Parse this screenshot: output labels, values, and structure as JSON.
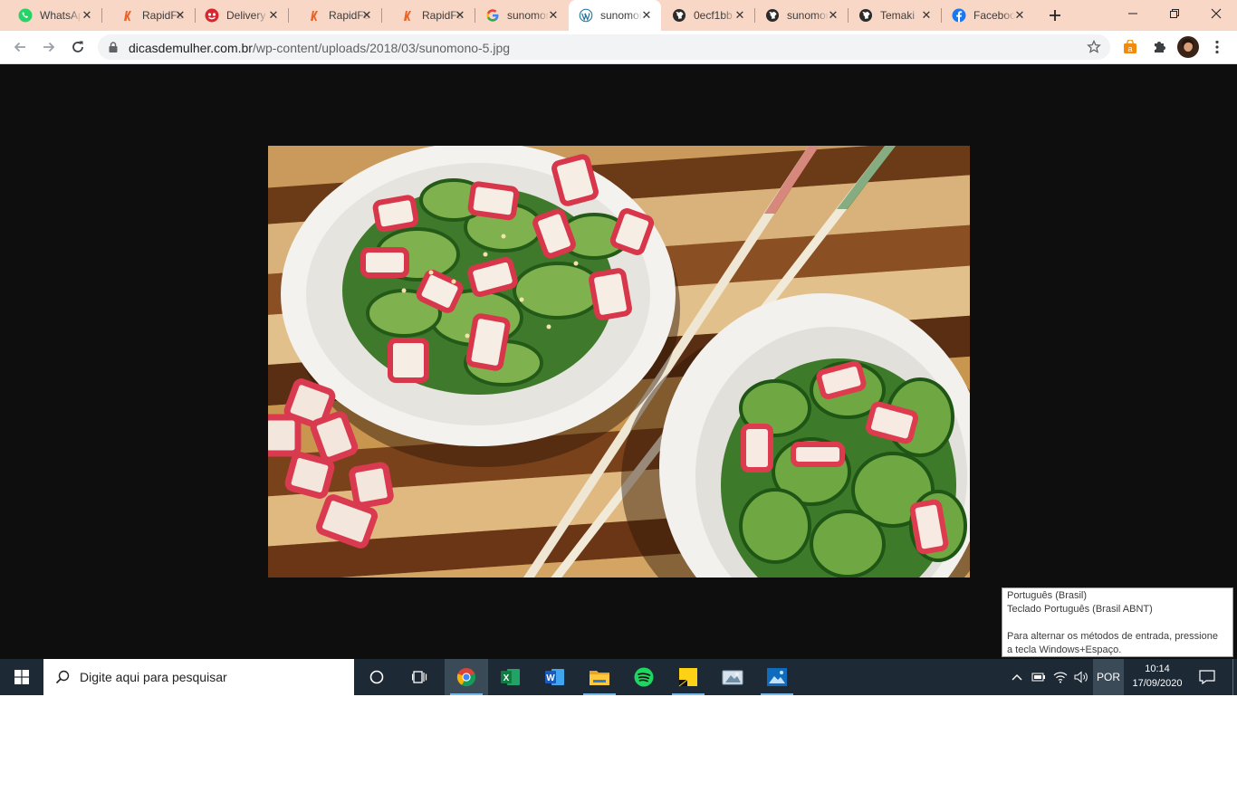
{
  "tabs": [
    {
      "title": "WhatsApp",
      "icon": "whatsapp-icon"
    },
    {
      "title": "RapidFood",
      "icon": "rapidfood-icon"
    },
    {
      "title": "Delivery",
      "icon": "delivery-icon"
    },
    {
      "title": "RapidFood",
      "icon": "rapidfood-icon"
    },
    {
      "title": "RapidFood",
      "icon": "rapidfood-icon"
    },
    {
      "title": "sunomono",
      "icon": "google-icon"
    },
    {
      "title": "sunomono",
      "icon": "wordpress-icon"
    },
    {
      "title": "0ecf1bb",
      "icon": "globe-icon"
    },
    {
      "title": "sunomono",
      "icon": "globe-icon"
    },
    {
      "title": "Temaki",
      "icon": "globe-icon"
    },
    {
      "title": "Facebook",
      "icon": "facebook-icon"
    }
  ],
  "address_bar": {
    "host": "dicasdemulher.com.br",
    "path": "/wp-content/uploads/2018/03/sunomono-5.jpg"
  },
  "image": {
    "icon": "sunomono-photo",
    "description_visible": false
  },
  "ime_tooltip": {
    "line1": "Português (Brasil)",
    "line2": "Teclado Português (Brasil ABNT)",
    "line3": "Para alternar os métodos de entrada, pressione",
    "line4": "a tecla Windows+Espaço."
  },
  "taskbar": {
    "search_placeholder": "Digite aqui para pesquisar",
    "language": "POR",
    "time": "10:14",
    "date": "17/09/2020"
  },
  "colors": {
    "tabstrip": "#f8d7c6",
    "viewer_bg": "#0e0e0e",
    "taskbar": "#1d2a36",
    "accent": "#76b9ed"
  }
}
